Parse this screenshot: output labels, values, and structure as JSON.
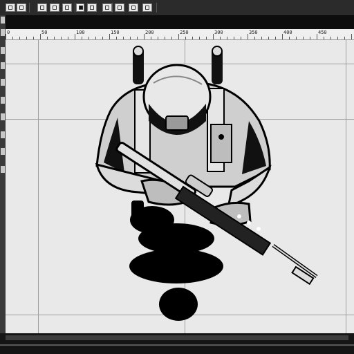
{
  "ruler": {
    "labels": [
      "0",
      "50",
      "100",
      "150",
      "200",
      "250",
      "300",
      "350",
      "400",
      "450"
    ]
  },
  "canvas": {
    "subject": "figure-illustration"
  },
  "colors": {
    "ink": "#000000",
    "paper": "#e9e9e9",
    "chrome": "#2b2b2b"
  }
}
